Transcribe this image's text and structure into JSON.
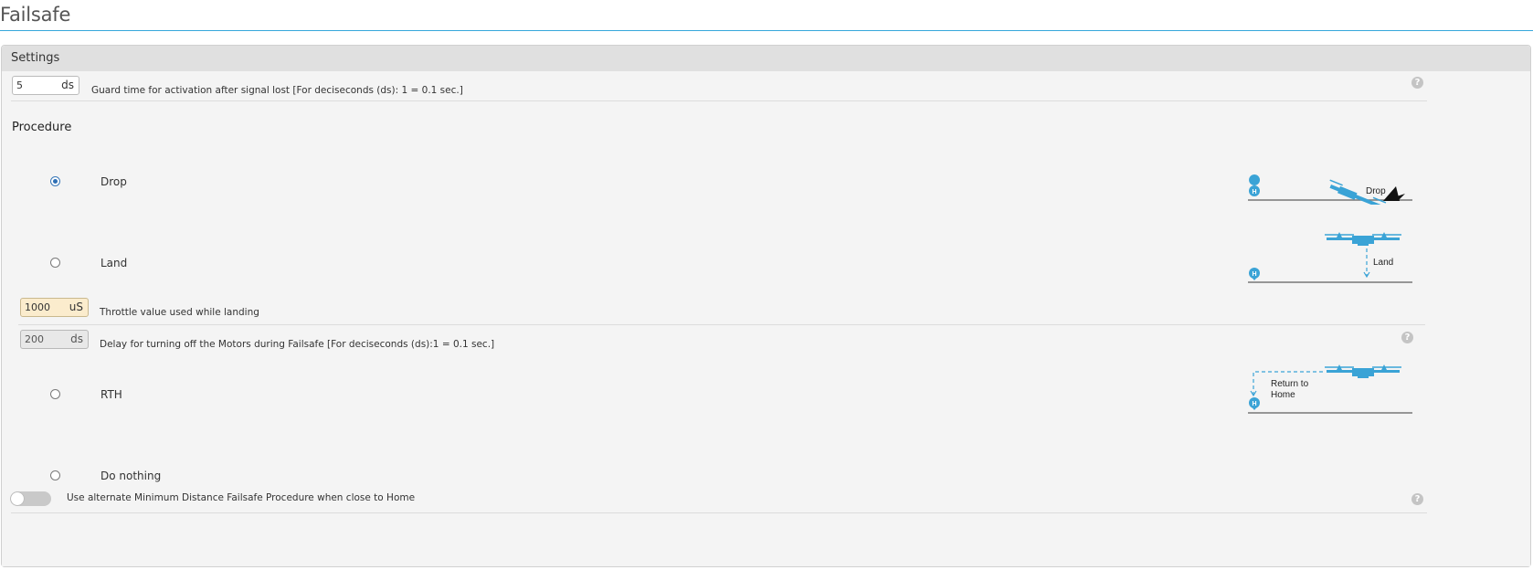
{
  "page": {
    "title": "Failsafe"
  },
  "settings": {
    "header": "Settings",
    "guard_time": {
      "value": "5",
      "unit": "ds",
      "description": "Guard time for activation after signal lost [For deciseconds (ds): 1 = 0.1 sec.]"
    }
  },
  "procedure": {
    "title": "Procedure",
    "options": [
      {
        "label": "Drop",
        "selected": true,
        "illustration_label": "Drop"
      },
      {
        "label": "Land",
        "selected": false,
        "illustration_label": "Land"
      },
      {
        "label": "RTH",
        "selected": false,
        "illustration_label_line1": "Return to",
        "illustration_label_line2": "Home"
      },
      {
        "label": "Do nothing",
        "selected": false
      }
    ],
    "throttle": {
      "value": "1000",
      "unit": "uS",
      "description": "Throttle value used while landing"
    },
    "motor_delay": {
      "value": "200",
      "unit": "ds",
      "description": "Delay for turning off the Motors during Failsafe [For deciseconds (ds):1 = 0.1 sec.]"
    },
    "min_distance": {
      "label": "Use alternate Minimum Distance Failsafe Procedure when close to Home",
      "enabled": false
    }
  },
  "icons": {
    "help": "?",
    "home_marker": "H"
  },
  "colors": {
    "accent": "#37a8db",
    "drone": "#3aa3d6",
    "selected_radio": "#2e6fb5",
    "warn_input": "#fbeccd"
  }
}
